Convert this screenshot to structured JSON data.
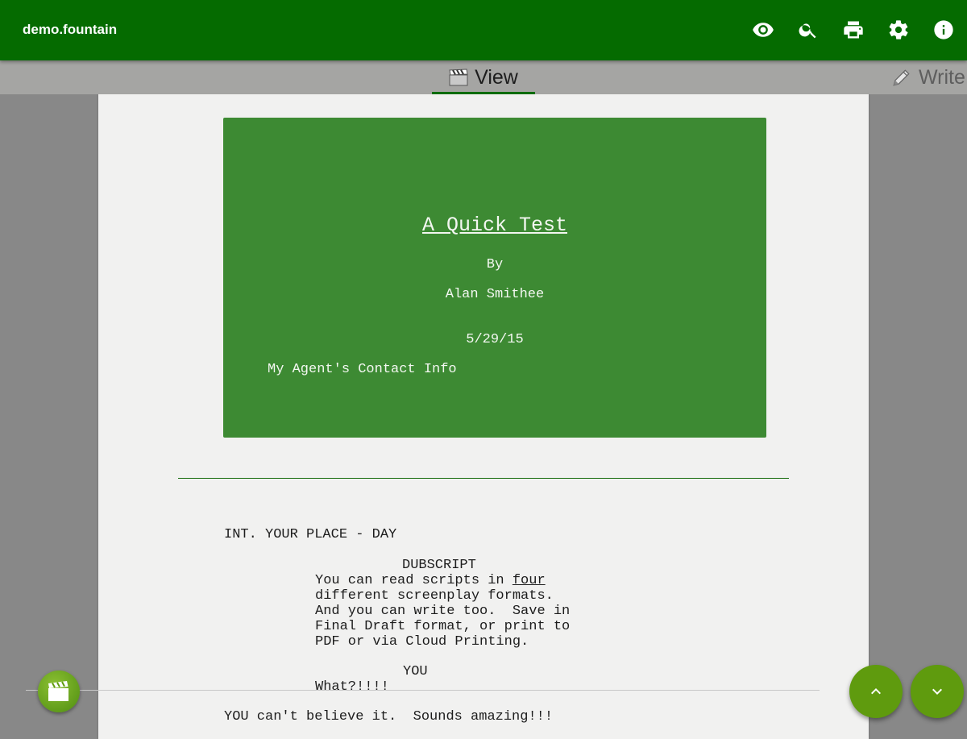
{
  "app": {
    "title": "demo.fountain"
  },
  "toolbar": {
    "actions": [
      "eye-icon",
      "search-icon",
      "print-icon",
      "settings-icon",
      "info-icon"
    ]
  },
  "tabs": [
    {
      "label": "View",
      "icon": "clapperboard-icon",
      "selected": true
    },
    {
      "label": "Write",
      "icon": "pencil-icon",
      "selected": false
    }
  ],
  "title_page": {
    "title": "A Quick Test",
    "credit": "By",
    "author": "Alan Smithee",
    "date": "5/29/15",
    "contact": "My Agent's Contact Info"
  },
  "script": {
    "scene_heading": "INT. YOUR PLACE - DAY",
    "character1": "DUBSCRIPT",
    "dialogue1_line1_a": "You can read scripts in ",
    "dialogue1_line1_u": "four",
    "dialogue1_line2": "different screenplay formats.",
    "dialogue1_line3": "And you can write too.  Save in",
    "dialogue1_line4": "Final Draft format, or print to",
    "dialogue1_line5": "PDF or via Cloud Printing.",
    "character2": "YOU",
    "dialogue2": "What?!!!!",
    "action1": "YOU can't believe it.  Sounds amazing!!!"
  },
  "colors": {
    "appbar": "#056b00",
    "title_page_bg": "#3d8a33",
    "fab": "#5f9b0e",
    "tab_indicator": "#0a6c00"
  }
}
